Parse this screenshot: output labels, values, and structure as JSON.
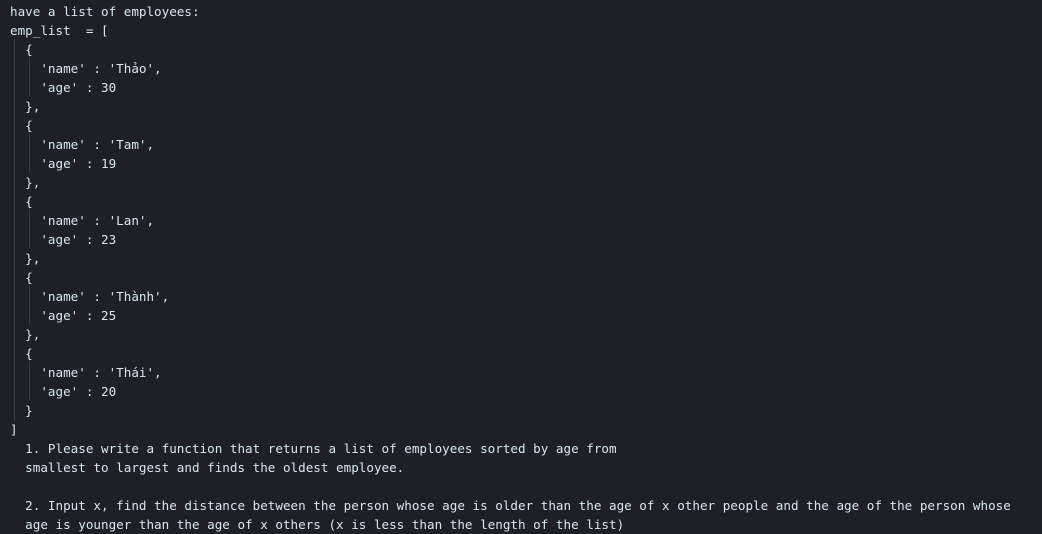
{
  "editor": {
    "lines": [
      "have a list of employees:",
      "emp_list  = [",
      "  {",
      "    'name' : 'Thảo',",
      "    'age' : 30",
      "  },",
      "  {",
      "    'name' : 'Tam',",
      "    'age' : 19",
      "  },",
      "  {",
      "    'name' : 'Lan',",
      "    'age' : 23",
      "  },",
      "  {",
      "    'name' : 'Thành',",
      "    'age' : 25",
      "  },",
      "  {",
      "    'name' : 'Thái',",
      "    'age' : 20",
      "  }",
      "]",
      "  1. Please write a function that returns a list of employees sorted by age from",
      "  smallest to largest and finds the oldest employee.",
      "",
      "  2. Input x, find the distance between the person whose age is older than the age of x other people and the age of the person whose",
      "  age is younger than the age of x others (x is less than the length of the list)"
    ]
  }
}
